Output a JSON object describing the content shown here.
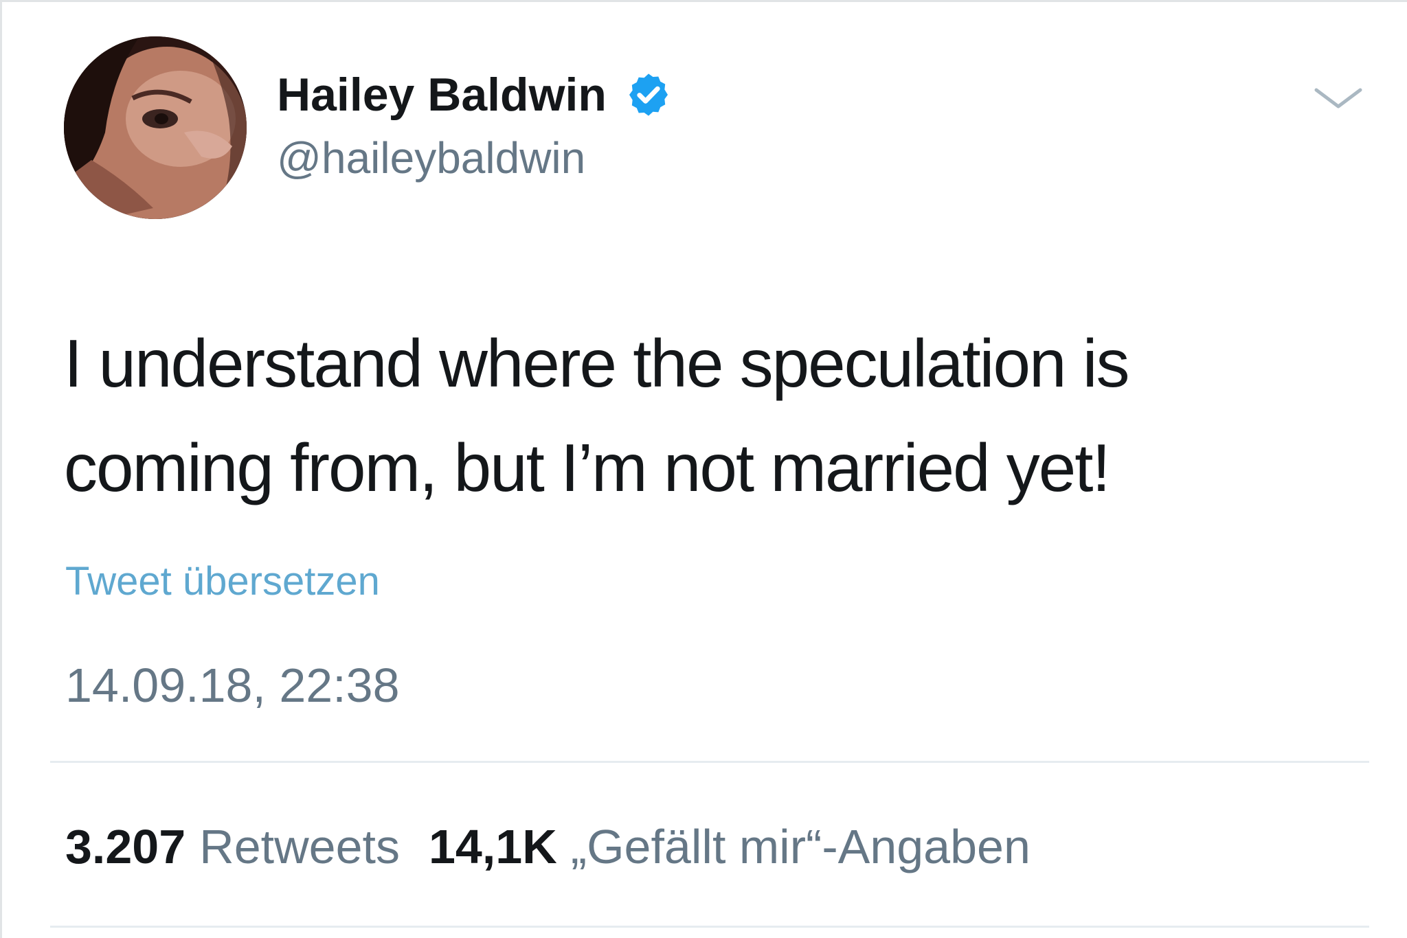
{
  "tweet": {
    "author": {
      "display_name": "Hailey Baldwin",
      "handle": "@haileybaldwin",
      "verified": true
    },
    "text_lines": [
      "I understand where the speculation is",
      "coming from, but I’m not married yet!"
    ],
    "translate_label": "Tweet übersetzen",
    "timestamp": "14.09.18, 22:38",
    "stats": {
      "retweets_count": "3.207",
      "retweets_label": "Retweets",
      "likes_count": "14,1K",
      "likes_label": "„Gefällt mir“-Angaben"
    }
  },
  "icons": {
    "verified": "verified-badge-icon",
    "menu": "chevron-down-icon"
  },
  "colors": {
    "verified_blue": "#1da1f2",
    "link_blue": "#5fa8d0",
    "secondary_text": "#657786",
    "primary_text": "#14171a",
    "divider": "#e6ecf0"
  }
}
